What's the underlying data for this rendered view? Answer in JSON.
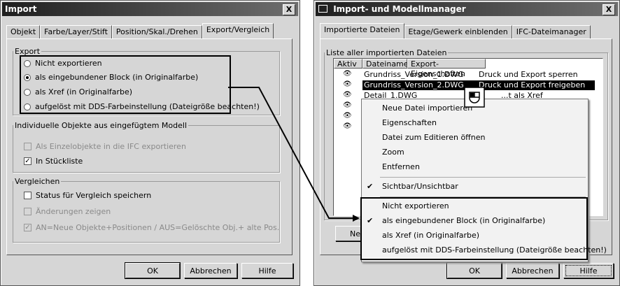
{
  "left_dialog": {
    "title": "Import",
    "close": "X",
    "tabs": [
      "Objekt",
      "Farbe/Layer/Stift",
      "Position/Skal./Drehen",
      "Export/Vergleich"
    ],
    "export_group": {
      "label": "Export",
      "options": [
        {
          "label": "Nicht exportieren",
          "selected": false
        },
        {
          "label": "als eingebundener Block (in Originalfarbe)",
          "selected": true
        },
        {
          "label": "als Xref (in Originalfarbe)",
          "selected": false
        },
        {
          "label": "aufgelöst mit DDS-Farbeinstellung (Dateigröße beachten!)",
          "selected": false
        }
      ]
    },
    "objects_group": {
      "label": "Individuelle Objekte aus eingefügtem Modell",
      "items": [
        {
          "label": "Als Einzelobjekte in die IFC exportieren",
          "checked": false,
          "disabled": true
        },
        {
          "label": "In Stückliste",
          "checked": true,
          "disabled": false
        }
      ]
    },
    "compare_group": {
      "label": "Vergleichen",
      "items": [
        {
          "label": "Status für Vergleich speichern",
          "checked": false,
          "disabled": false
        },
        {
          "label": "Änderungen zeigen",
          "checked": false,
          "disabled": true
        },
        {
          "label": "AN=Neue Objekte+Positionen / AUS=Gelöschte Obj.+ alte Pos.",
          "checked": true,
          "disabled": true
        }
      ]
    },
    "buttons": {
      "ok": "OK",
      "cancel": "Abbrechen",
      "help": "Hilfe"
    }
  },
  "right_dialog": {
    "title": "Import- und Modellmanager",
    "close": "X",
    "tabs": [
      "Importierte Dateien",
      "Etage/Gewerk einblenden",
      "IFC-Dateimanager"
    ],
    "list_group_label": "Liste aller importierten Dateien",
    "columns": [
      "Aktiv",
      "Dateiname",
      "Export-Eigenschaften"
    ],
    "rows": [
      {
        "name": "Grundriss_Version_1.DWG",
        "export": "Druck und Export sperren",
        "selected": false
      },
      {
        "name": "Grundriss_Version_2.DWG",
        "export": "Druck und Export freigeben",
        "selected": true
      },
      {
        "name": "Detail_1.DWG",
        "export": "...t als Xref",
        "selected": false
      }
    ],
    "new_button_partial": "Neu",
    "buttons": {
      "ok": "OK",
      "cancel": "Abbrechen",
      "help": "Hilfe"
    },
    "context_menu": {
      "items_top": [
        "Neue Datei importieren",
        "Eigenschaften",
        "Datei zum Editieren öffnen",
        "Zoom",
        "Entfernen"
      ],
      "toggle": {
        "label": "Sichtbar/Unsichtbar",
        "checked": true
      },
      "export_items": [
        {
          "label": "Nicht exportieren",
          "checked": false
        },
        {
          "label": "als eingebundener Block (in Originalfarbe)",
          "checked": true
        },
        {
          "label": "als Xref (in Originalfarbe)",
          "checked": false
        },
        {
          "label": "aufgelöst mit DDS-Farbeinstellung (Dateigröße beachten!)",
          "checked": false
        }
      ]
    }
  },
  "icons": {
    "eye": "eye-icon",
    "mouse": "mouse-icon",
    "arrow": "connector-arrow"
  },
  "colors": {
    "dialog_bg": "#d6d6d6",
    "title_bar": "#1f1f1f",
    "selection": "#000000",
    "menu_bg": "#f2f2f2"
  }
}
